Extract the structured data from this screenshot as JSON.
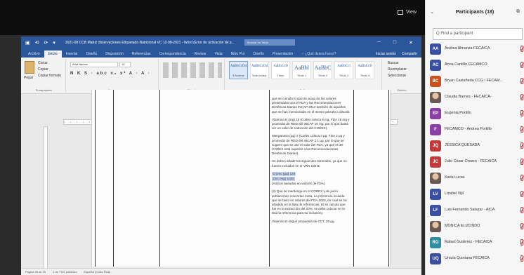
{
  "meeting": {
    "view_label": "View"
  },
  "word": {
    "title": "2021-08 CCB Matriz observaciones Etiquetado Nutricional VC 12-08-2021 - Word (Error de activación de p...",
    "ribbon_display": "Mostrar en Tabla",
    "quick_access": [
      "⟲",
      "⟳",
      "▾"
    ],
    "window_controls": [
      "─",
      "□",
      "✕"
    ],
    "tabs": [
      "Archivo",
      "Inicio",
      "Insertar",
      "Diseño",
      "Disposición",
      "Referencias",
      "Correspondencia",
      "Revisar",
      "Vista",
      "Nitro Pro",
      "Diseño",
      "Presentación"
    ],
    "active_tab_index": 1,
    "tell_me": "♀ ¿Qué desea hacer?",
    "right_tabs": [
      "Iniciar sesión",
      "Compartir"
    ],
    "clipboard": {
      "paste": "Pegar",
      "cut": "Cortar",
      "copy": "Copiar",
      "format": "Copiar formato",
      "label": "Portapapeles"
    },
    "font": {
      "name": "Arial Narrow",
      "size": "10",
      "row2": "N K S · abc x₂ x² A · A ·",
      "label": "Fuente"
    },
    "paragraph_label": "Párrafo",
    "styles": [
      {
        "sample": "AaBbCcDd",
        "name": "¶ Normal",
        "big": false,
        "active": true
      },
      {
        "sample": "AaBbCcDd",
        "name": "Texto indep.",
        "big": false,
        "active": false
      },
      {
        "sample": "AaBbCcD",
        "name": "Título",
        "big": false,
        "active": false
      },
      {
        "sample": "AaBbl",
        "name": "Título 1",
        "big": true,
        "active": false
      },
      {
        "sample": "AaBbC",
        "name": "Título 2",
        "big": true,
        "active": false
      },
      {
        "sample": "AaBbCcl",
        "name": "Título 3",
        "big": false,
        "active": false
      },
      {
        "sample": "AaBbCcD",
        "name": "Título 4",
        "big": false,
        "active": false
      }
    ],
    "styles_label": "Estilos",
    "editing": {
      "find": "Buscar",
      "replace": "Reemplazar",
      "select": "Seleccionar",
      "label": "Edición"
    },
    "status": [
      "Página 25 de 45",
      "4 de 7161 palabras",
      "Español (Costa Rica)"
    ]
  },
  "document": {
    "paragraphs": [
      {
        "text": "que se cumpla lo que se acoja de los valores presentados por el FDA y las Recomendaciones Dietéticas Diarias INCAP 2012 también de aquellos que se han mencionado en el mismo párrafo a discutir."
      },
      {
        "text": "Vitamina E (mg) 15 (Codex coloca 9 mg, FDA 15 mg y promedio de RDD del INCAP 10 mg, por lo que basta ver un valor de reducción del CODEX)."
      },
      {
        "text": "Manganeso (µg) 2 (Codex coloca 3 µg, FDA 2 µg y promedio de RDD del INCAP 2.1 µg, por lo que se sugiere que se use el valor del FDA, ya que el del CODEX está superior a las Recomendaciones Dietéticas Diarias)."
      },
      {
        "text": "Se deben añadir los siguientes minerales, ya que no fueron incluidos en el VRN 100 B:"
      },
      {
        "text": "Cromo (µg) 120",
        "highlight": true
      },
      {
        "text": "Zinc (mg) 1400",
        "highlight": true
      },
      {
        "text": "(Ambos basados en valores de FDA)"
      },
      {
        "text": "(2) Que se mantenga en el CODEX y de juicio poblaciones concretas meta. La referencia incluida que se basó en valores del FDA 2020, en cual se ha añadido en la lista de referencias. El se calcula que fue en la extracción del 20%, se debe colocar en la lista la referencia para su inclusión)."
      },
      {
        "text": "Vitamina D seguir propuesta de CCT, 20 µg."
      }
    ]
  },
  "participants": {
    "title": "Participants (18)",
    "search_placeholder": "Q Find a participant",
    "list": [
      {
        "initials": "AA",
        "name": "Andrea Almanza FECAICA",
        "color": "#3a4fa1",
        "photo": false
      },
      {
        "initials": "AC",
        "name": "Anna Cantillo FECAMCO",
        "color": "#3a4fa1",
        "photo": false
      },
      {
        "initials": "BC",
        "name": "Bryan Castañeda CCG / FECAM...",
        "color": "#c9531f",
        "photo": false
      },
      {
        "initials": "",
        "name": "Claudia Barnes - FECAICA-",
        "color": "#6a5a52",
        "photo": true
      },
      {
        "initials": "EP",
        "name": "Eugenia Portillo",
        "color": "#8c3fa6",
        "photo": false
      },
      {
        "initials": "F",
        "name": "FECAMCO - Andrea Portillo",
        "color": "#8c3fa6",
        "photo": false
      },
      {
        "initials": "JQ",
        "name": "JESSICA QUESADA",
        "color": "#c23a3a",
        "photo": false
      },
      {
        "initials": "JC",
        "name": "Julio César Orozco - FECAICA",
        "color": "#c23a3a",
        "photo": false
      },
      {
        "initials": "",
        "name": "Karla Lucas",
        "color": "#6a5a52",
        "photo": true
      },
      {
        "initials": "LV",
        "name": "Lizabel Vijil",
        "color": "#3a4fa1",
        "photo": false
      },
      {
        "initials": "LF",
        "name": "Luis Fernando Salazar - AICA",
        "color": "#3a4fa1",
        "photo": false
      },
      {
        "initials": "",
        "name": "MONICA ELIZONDO",
        "color": "#6a5a52",
        "photo": true
      },
      {
        "initials": "RG",
        "name": "Rafael Gutiérrez - FECAICA",
        "color": "#2f8fa1",
        "photo": false
      },
      {
        "initials": "UQ",
        "name": "Ursula Quintana FECAICA",
        "color": "#3a4fa1",
        "photo": false
      }
    ]
  }
}
